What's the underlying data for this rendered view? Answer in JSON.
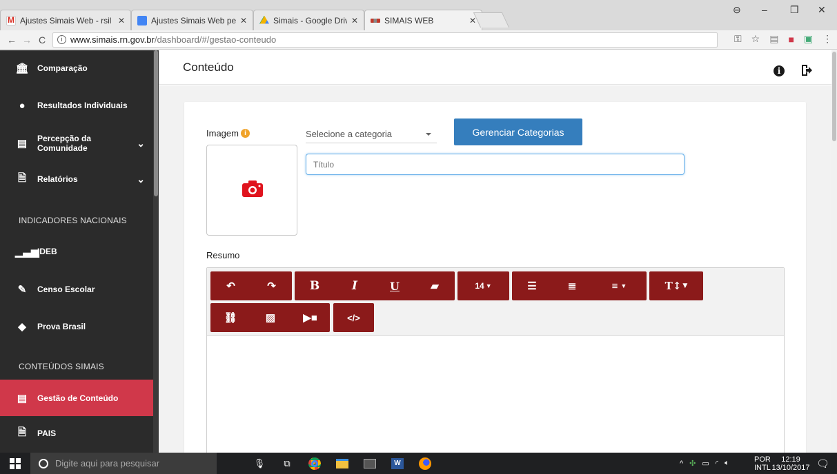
{
  "browser": {
    "tabs": [
      {
        "title": "Ajustes Simais Web - rsil",
        "favicon": "gmail-icon"
      },
      {
        "title": "Ajustes Simais Web pend",
        "favicon": "docs-icon"
      },
      {
        "title": "Simais - Google Drive",
        "favicon": "drive-icon"
      },
      {
        "title": "SIMAIS WEB",
        "favicon": "simais-icon",
        "active": true
      }
    ],
    "url_host": "www.simais.rn.gov.br",
    "url_path": "/dashboard/#/gestao-conteudo"
  },
  "sidebar": {
    "items": [
      {
        "label": "Comparação",
        "icon": "institution-icon"
      },
      {
        "label": "Resultados Individuais",
        "icon": "head-icon"
      },
      {
        "label": "Percepção da Comunidade",
        "icon": "newspaper-icon",
        "expandable": true
      },
      {
        "label": "Relatórios",
        "icon": "file-icon",
        "expandable": true
      },
      {
        "label": "IDEB",
        "icon": "signal-icon"
      },
      {
        "label": "Censo Escolar",
        "icon": "pencil-icon"
      },
      {
        "label": "Prova Brasil",
        "icon": "brazil-map-icon"
      },
      {
        "label": "Gestão de Conteúdo",
        "icon": "newspaper-icon",
        "active": true
      },
      {
        "label": "PAIS",
        "icon": "file-icon"
      }
    ],
    "sections": {
      "indicadores": "INDICADORES NACIONAIS",
      "conteudos": "CONTEÚDOS SIMAIS"
    }
  },
  "header": {
    "title": "Conteúdo"
  },
  "form": {
    "image_label": "Imagem",
    "category_placeholder": "Selecione a categoria",
    "manage_categories_button": "Gerenciar Categorias",
    "title_placeholder": "Título",
    "summary_label": "Resumo",
    "font_size": "14"
  },
  "taskbar": {
    "search_placeholder": "Digite aqui para pesquisar",
    "lang_top": "POR",
    "lang_bottom": "INTL",
    "time": "12:19",
    "date": "13/10/2017"
  },
  "colors": {
    "sidebar_bg": "#2b2b2b",
    "active_item": "#d0384a",
    "toolbar_button": "#8b1a1a",
    "primary_button": "#357ebd",
    "camera": "#e0141e"
  }
}
